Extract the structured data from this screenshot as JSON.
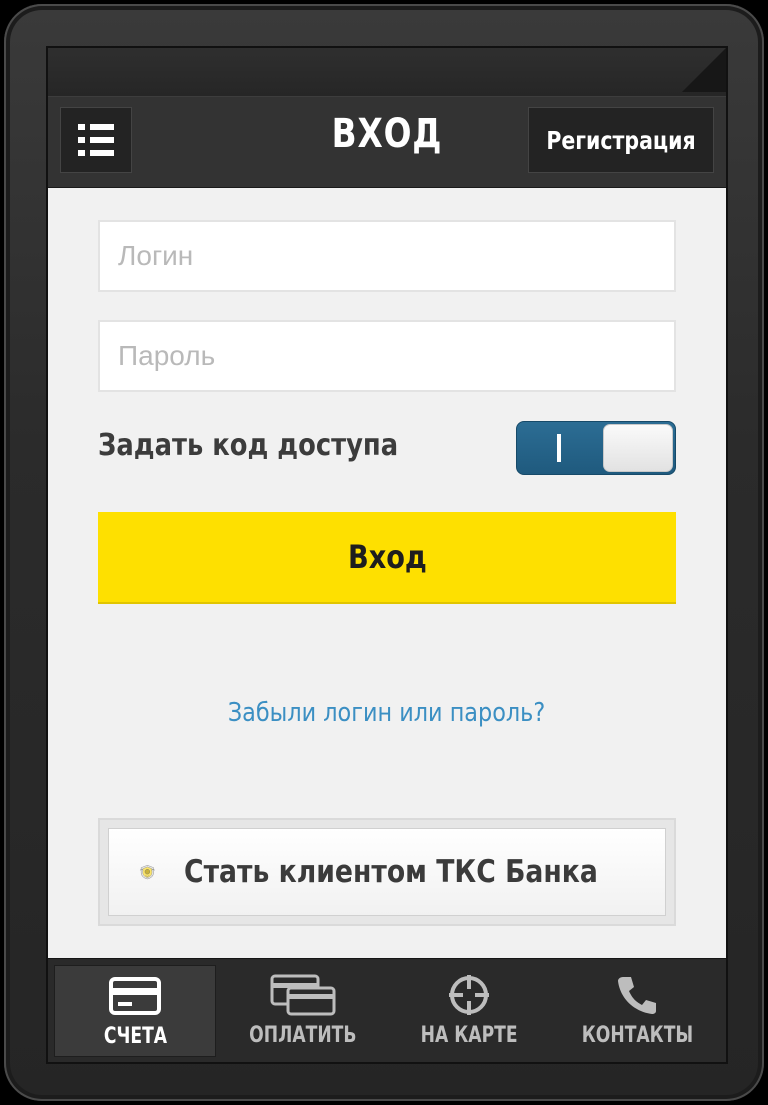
{
  "header": {
    "title": "ВХОД",
    "register_label": "Регистрация",
    "menu_icon": "menu-icon"
  },
  "form": {
    "login_placeholder": "Логин",
    "login_value": "",
    "password_placeholder": "Пароль",
    "password_value": "",
    "pin_label": "Задать код доступа",
    "pin_toggle_on": true,
    "submit_label": "Вход",
    "forgot_link": "Забыли логин или пароль?",
    "become_client_label": "Стать клиентом ТКС Банка"
  },
  "tabs": [
    {
      "label": "СЧЕТА",
      "icon": "card-icon",
      "active": true
    },
    {
      "label": "ОПЛАТИТЬ",
      "icon": "payment-cards-icon",
      "active": false
    },
    {
      "label": "НА КАРТЕ",
      "icon": "crosshair-icon",
      "active": false
    },
    {
      "label": "КОНТАКТЫ",
      "icon": "phone-icon",
      "active": false
    }
  ],
  "colors": {
    "accent_yellow": "#fee000",
    "toggle_blue": "#256489",
    "link_blue": "#3b8fc3",
    "header_dark": "#333333"
  }
}
